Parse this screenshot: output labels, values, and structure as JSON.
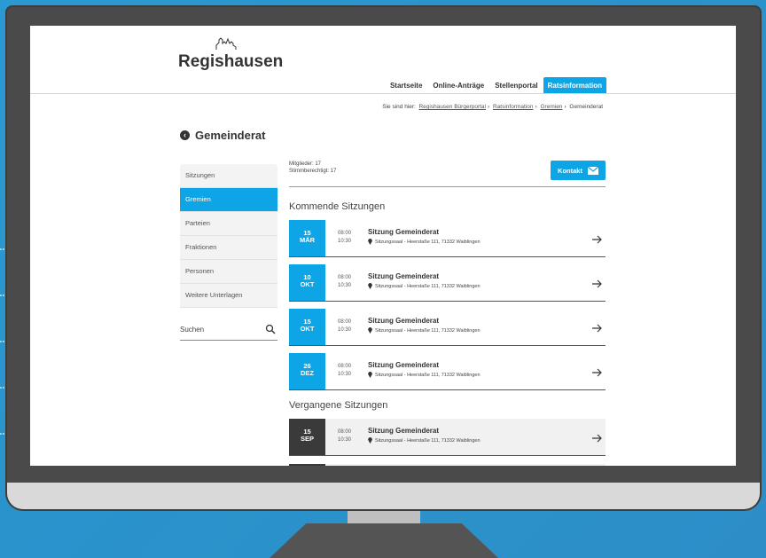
{
  "site": {
    "logo_text": "Regishausen"
  },
  "topnav": [
    "Startseite",
    "Online-Anträge",
    "Stellenportal",
    "Ratsinformation"
  ],
  "breadcrumb": {
    "prefix": "Sie sind hier:",
    "items": [
      "Regishausen Bürgerportal",
      "Ratsinformation",
      "Gremien",
      "Gemeinderat"
    ]
  },
  "page": {
    "title": "Gemeinderat"
  },
  "sidebar": {
    "items": [
      "Sitzungen",
      "Gremien",
      "Parteien",
      "Fraktionen",
      "Personen",
      "Weitere Unterlagen"
    ],
    "active": "Gremien",
    "search_placeholder": "Suchen"
  },
  "main": {
    "members": "Mitglieder: 17",
    "voting": "Stimmberechtigt: 17",
    "contact_label": "Kontakt",
    "upcoming_title": "Kommende Sitzungen",
    "past_title": "Vergangene Sitzungen",
    "upcoming": [
      {
        "day": "15",
        "month": "MÄR",
        "start": "08:00",
        "end": "10:30",
        "title": "Sitzung Gemeinderat",
        "location": "Sitzungssaal - Heerstaße 111, 71332 Waiblingen"
      },
      {
        "day": "10",
        "month": "OKT",
        "start": "08:00",
        "end": "10:30",
        "title": "Sitzung Gemeinderat",
        "location": "Sitzungssaal - Heerstaße 111, 71332 Waiblingen"
      },
      {
        "day": "15",
        "month": "OKT",
        "start": "08:00",
        "end": "10:30",
        "title": "Sitzung Gemeinderat",
        "location": "Sitzungssaal - Heerstaße 111, 71332 Waiblingen"
      },
      {
        "day": "26",
        "month": "DEZ",
        "start": "08:00",
        "end": "10:30",
        "title": "Sitzung Gemeinderat",
        "location": "Sitzungssaal - Heerstaße 111, 71332 Waiblingen"
      }
    ],
    "past": [
      {
        "day": "15",
        "month": "SEP",
        "start": "08:00",
        "end": "10:30",
        "title": "Sitzung Gemeinderat",
        "location": "Sitzungssaal - Heerstaße 111, 71332 Waiblingen"
      }
    ]
  },
  "colors": {
    "accent": "#0ea5e6",
    "past": "#3a3a3a",
    "background": "#2b9ad2"
  },
  "icons": {
    "back": "arrow-left-circle-icon",
    "search": "search-icon",
    "contact": "envelope-icon",
    "event": "arrow-right-icon",
    "location": "map-pin-icon"
  }
}
